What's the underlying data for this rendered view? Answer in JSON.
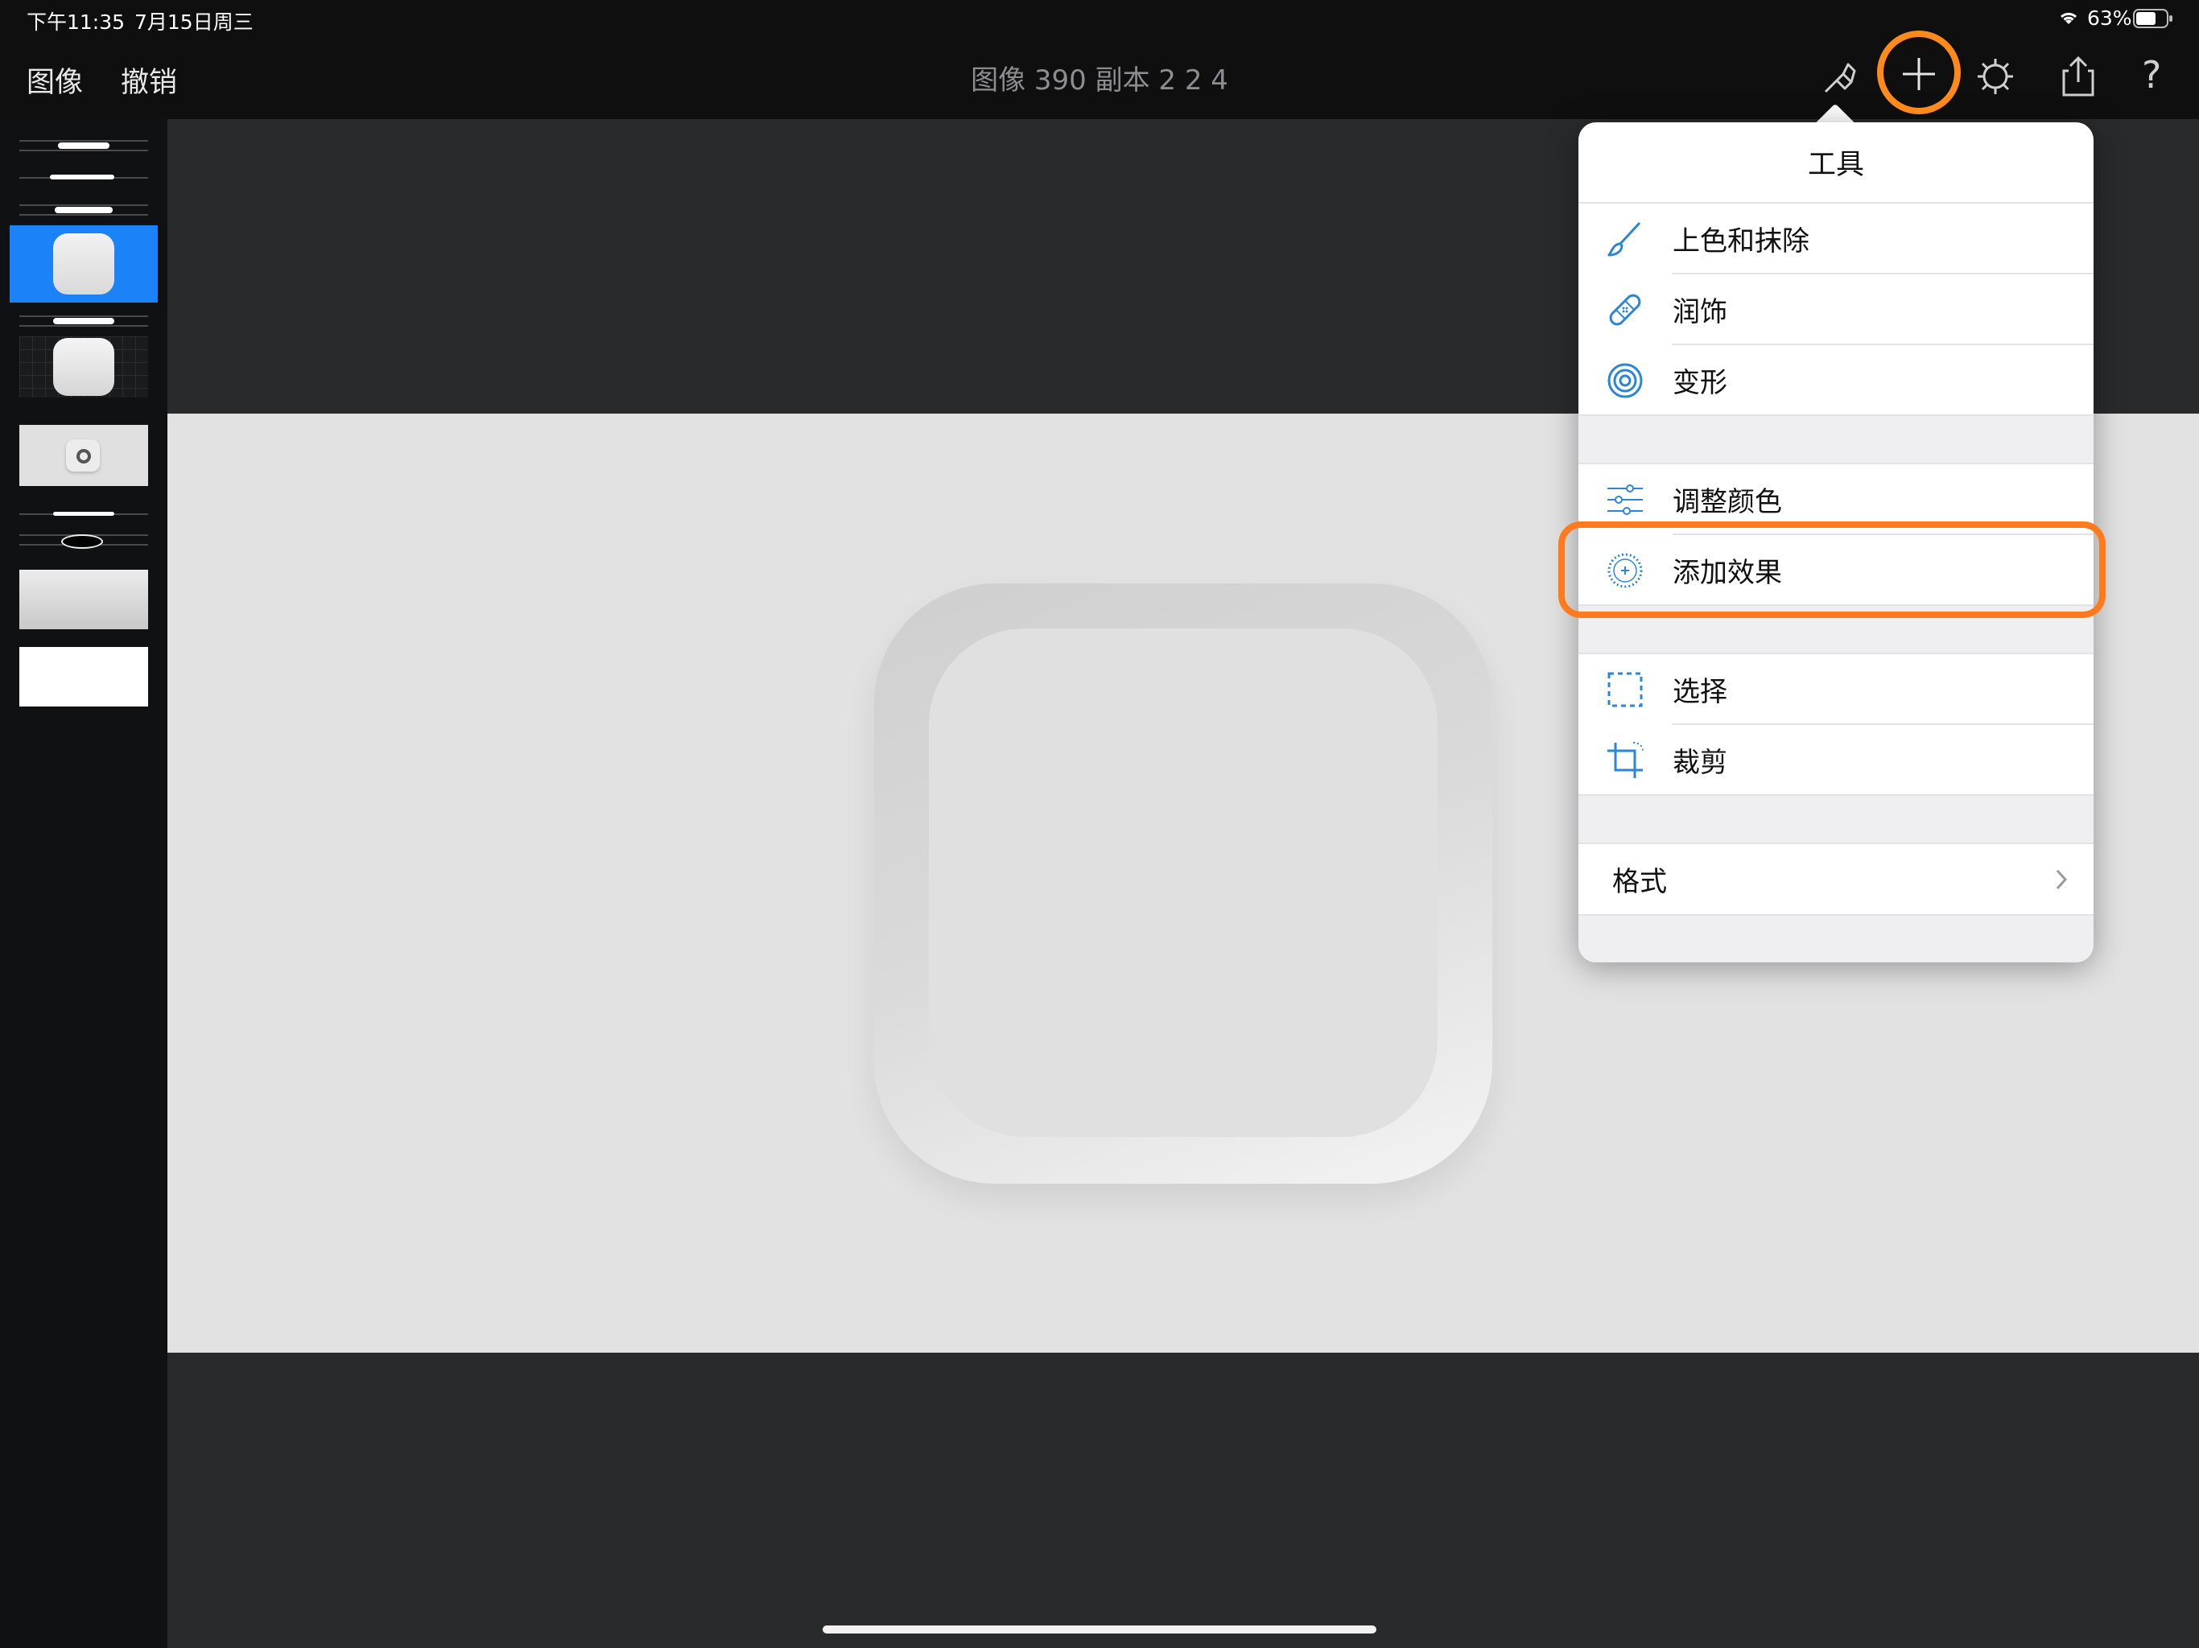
{
  "status_bar": {
    "time": "下午11:35",
    "date": "7月15日周三",
    "battery": "63%"
  },
  "toolbar": {
    "image_label": "图像",
    "undo_label": "撤销",
    "title": "图像 390 副本 2 2 4",
    "help_label": "?"
  },
  "popover": {
    "title": "工具",
    "items": [
      {
        "label": "上色和抹除",
        "icon": "brush-icon"
      },
      {
        "label": "润饰",
        "icon": "bandage-icon"
      },
      {
        "label": "变形",
        "icon": "spiral-icon"
      },
      {
        "label": "调整颜色",
        "icon": "sliders-icon"
      },
      {
        "label": "添加效果",
        "icon": "sparkle-circle-icon"
      },
      {
        "label": "选择",
        "icon": "selection-icon"
      },
      {
        "label": "裁剪",
        "icon": "crop-icon"
      },
      {
        "label": "格式",
        "icon": "chevron-right-icon"
      }
    ]
  },
  "colors": {
    "accent_blue": "#1b82f7",
    "highlight_orange": "#ff7a1c",
    "icon_blue": "#2b86d8"
  }
}
